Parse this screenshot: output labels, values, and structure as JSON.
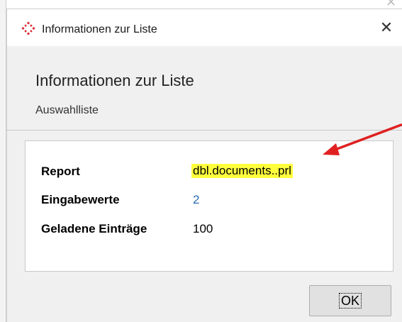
{
  "window": {
    "title": "Informationen zur Liste",
    "close_glyph": "✕"
  },
  "header": {
    "heading": "Informationen zur Liste",
    "subheading": "Auswahlliste"
  },
  "details": {
    "rows": [
      {
        "label": "Report",
        "value": "dbl.documents..prl"
      },
      {
        "label": "Eingabewerte",
        "value": "2"
      },
      {
        "label": "Geladene Einträge",
        "value": "100"
      }
    ]
  },
  "footer": {
    "ok_label": "OK"
  },
  "icons": {
    "app": "red-diamond-dots-icon",
    "close": "close-icon",
    "annotation": "red-arrow"
  },
  "colors": {
    "highlight": "#ffff3d",
    "link": "#2b6cb0",
    "arrow": "#e02020",
    "app_icon": "#d9303a"
  }
}
